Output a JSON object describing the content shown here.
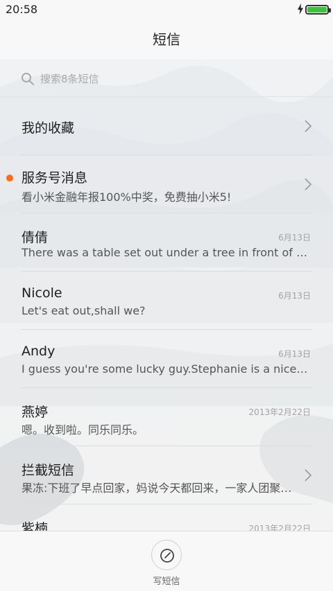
{
  "status_bar": {
    "time": "20:58",
    "battery_level": 1.0,
    "charging": true
  },
  "header": {
    "title": "短信"
  },
  "search": {
    "placeholder": "搜索8条短信"
  },
  "conversations": [
    {
      "name": "我的收藏",
      "preview": "",
      "date": "",
      "chevron": true,
      "unread_dot": false
    },
    {
      "name": "服务号消息",
      "preview": "看小米金融年报100%中奖，免费抽小米5!",
      "date": "",
      "chevron": true,
      "unread_dot": true
    },
    {
      "name": "倩倩",
      "preview": "There was a table set out under a tree in front of the house",
      "date": "6月13日",
      "chevron": false,
      "unread_dot": false
    },
    {
      "name": "Nicole",
      "preview": "Let's eat out,shall we?",
      "date": "6月13日",
      "chevron": false,
      "unread_dot": false
    },
    {
      "name": "Andy",
      "preview": "I guess you're some lucky guy.Stephanie is a nice girl.",
      "date": "6月13日",
      "chevron": false,
      "unread_dot": false
    },
    {
      "name": "燕婷",
      "preview": "嗯。收到啦。同乐同乐。",
      "date": "2013年2月22日",
      "chevron": false,
      "unread_dot": false
    },
    {
      "name": "拦截短信",
      "preview": "果冻:下班了早点回家，妈说今天都回来，一家人团聚过节",
      "date": "",
      "chevron": true,
      "unread_dot": false
    },
    {
      "name": "紫楠",
      "preview": "",
      "date": "2013年2月22日",
      "chevron": false,
      "unread_dot": false
    }
  ],
  "bottom_bar": {
    "compose_label": "写短信",
    "compose_icon": "compose-icon"
  },
  "colors": {
    "unread_dot": "#ff6a1c",
    "battery": "#3cc43c"
  }
}
